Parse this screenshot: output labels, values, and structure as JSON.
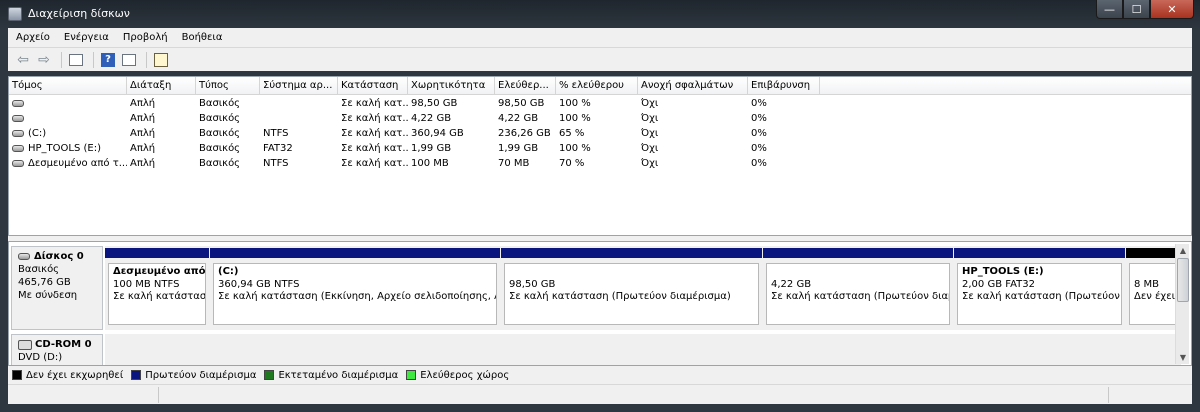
{
  "window": {
    "title": "Διαχείριση δίσκων",
    "minimize": "—",
    "maximize": "☐",
    "close": "✕"
  },
  "menu": [
    "Αρχείο",
    "Ενέργεια",
    "Προβολή",
    "Βοήθεια"
  ],
  "toolbar": {
    "back": "⇦",
    "forward": "⇨",
    "help": "?"
  },
  "volume_table": {
    "columns": [
      "Τόμος",
      "Διάταξη",
      "Τύπος",
      "Σύστημα αρ...",
      "Κατάσταση",
      "Χωρητικότητα",
      "Ελεύθερ...",
      "% ελεύθερου",
      "Ανοχή σφαλμάτων",
      "Επιβάρυνση"
    ],
    "rows": [
      {
        "volume": "",
        "layout": "Απλή",
        "type": "Βασικός",
        "fs": "",
        "status": "Σε καλή κατ...",
        "capacity": "98,50 GB",
        "free": "98,50 GB",
        "pct": "100 %",
        "fault": "Όχι",
        "overhead": "0%"
      },
      {
        "volume": "",
        "layout": "Απλή",
        "type": "Βασικός",
        "fs": "",
        "status": "Σε καλή κατ...",
        "capacity": "4,22 GB",
        "free": "4,22 GB",
        "pct": "100 %",
        "fault": "Όχι",
        "overhead": "0%"
      },
      {
        "volume": "(C:)",
        "layout": "Απλή",
        "type": "Βασικός",
        "fs": "NTFS",
        "status": "Σε καλή κατ...",
        "capacity": "360,94 GB",
        "free": "236,26 GB",
        "pct": "65 %",
        "fault": "Όχι",
        "overhead": "0%"
      },
      {
        "volume": "HP_TOOLS (E:)",
        "layout": "Απλή",
        "type": "Βασικός",
        "fs": "FAT32",
        "status": "Σε καλή κατ...",
        "capacity": "1,99 GB",
        "free": "1,99 GB",
        "pct": "100 %",
        "fault": "Όχι",
        "overhead": "0%"
      },
      {
        "volume": "Δεσμευμένο από τ...",
        "layout": "Απλή",
        "type": "Βασικός",
        "fs": "NTFS",
        "status": "Σε καλή κατ...",
        "capacity": "100 MB",
        "free": "70 MB",
        "pct": "70 %",
        "fault": "Όχι",
        "overhead": "0%"
      }
    ]
  },
  "disk0": {
    "name": "Δίσκος 0",
    "type": "Βασικός",
    "size": "465,76 GB",
    "status": "Με σύνδεση",
    "partitions": [
      {
        "name": "Δεσμευμένο από",
        "size": "100 MB NTFS",
        "status": "Σε καλή κατάστασι",
        "band": "primary"
      },
      {
        "name": "(C:)",
        "size": "360,94 GB NTFS",
        "status": "Σε καλή κατάσταση (Εκκίνηση, Αρχείο σελιδοποίησης, Ατ",
        "band": "primary"
      },
      {
        "name": "",
        "size": "98,50 GB",
        "status": "Σε καλή κατάσταση (Πρωτεύον διαμέρισμα)",
        "band": "primary"
      },
      {
        "name": "",
        "size": "4,22 GB",
        "status": "Σε καλή κατάσταση (Πρωτεύον διαμ",
        "band": "primary"
      },
      {
        "name": "HP_TOOLS  (E:)",
        "size": "2,00 GB FAT32",
        "status": "Σε καλή κατάσταση (Πρωτεύον δ",
        "band": "primary"
      },
      {
        "name": "",
        "size": "8 MB",
        "status": "Δεν έχει",
        "band": "unallocated"
      }
    ]
  },
  "cdrom0": {
    "name": "CD-ROM 0",
    "drive": "DVD (D:)"
  },
  "legend": [
    {
      "label": "Δεν έχει εκχωρηθεί",
      "color": "#000000"
    },
    {
      "label": "Πρωτεύον διαμέρισμα",
      "color": "#0b1580"
    },
    {
      "label": "Εκτεταμένο διαμέρισμα",
      "color": "#1f7a1f"
    },
    {
      "label": "Ελεύθερος χώρος",
      "color": "#3ee83e"
    }
  ]
}
